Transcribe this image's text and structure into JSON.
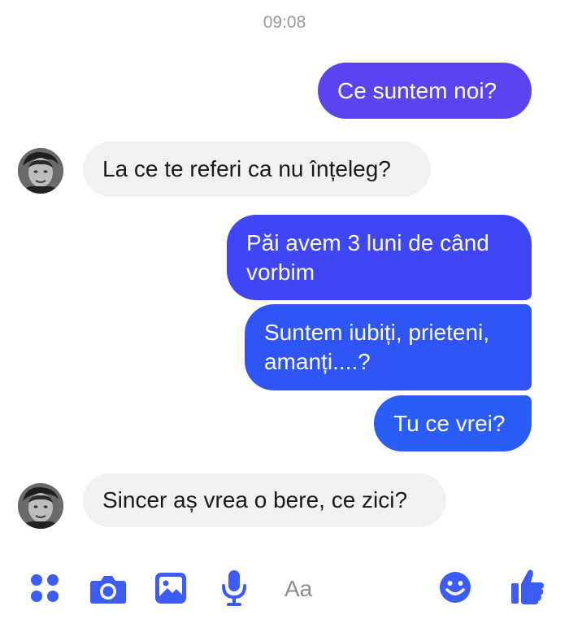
{
  "conversation": {
    "timestamp": "09:08",
    "messages": [
      {
        "from": "me",
        "text": "Ce suntem noi?"
      },
      {
        "from": "them",
        "text": "La ce te referi ca nu înțeleg?"
      },
      {
        "from": "me",
        "lines": [
          "Păi avem 3 luni de când",
          "vorbim"
        ]
      },
      {
        "from": "me",
        "lines": [
          "Suntem iubiți, prieteni,",
          "amanți....?"
        ]
      },
      {
        "from": "me",
        "text": "Tu ce vrei?"
      },
      {
        "from": "them",
        "text": "Sincer aș vrea o bere, ce zici?"
      }
    ]
  },
  "composer": {
    "placeholder": "Aa",
    "icons": [
      "apps-icon",
      "camera-icon",
      "gallery-icon",
      "microphone-icon",
      "emoji-icon",
      "thumbs-up-icon"
    ]
  },
  "colors": {
    "accent": "#3b5cf6",
    "outgoing_top": "#5b44f0",
    "incoming_bg": "#f1f1f4",
    "timestamp": "#9b9b9b"
  }
}
